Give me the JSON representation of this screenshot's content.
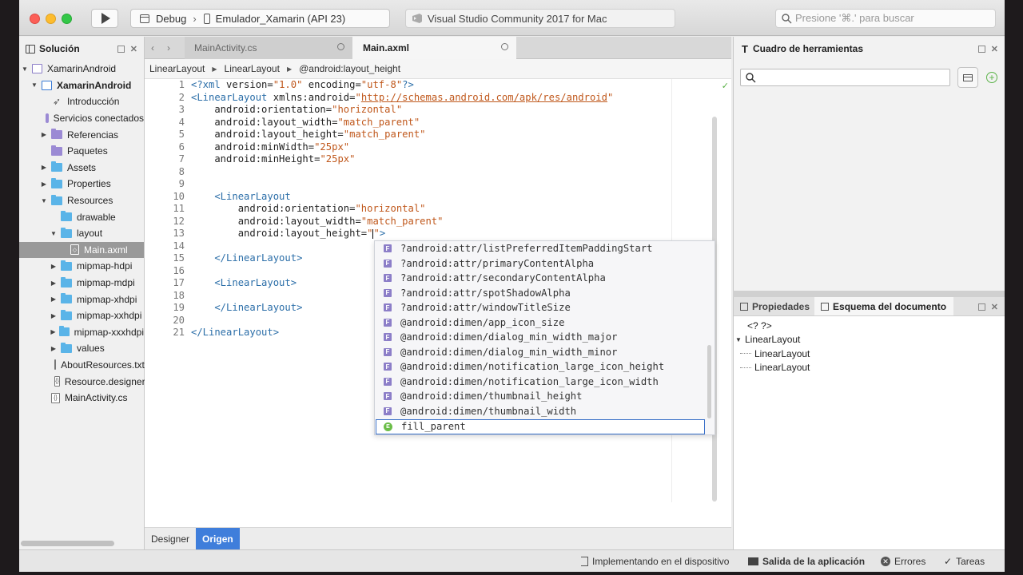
{
  "toolbar": {
    "config": "Debug",
    "device": "Emulador_Xamarin (API 23)",
    "app_title": "Visual Studio Community 2017 for Mac",
    "search_placeholder": "Presione '⌘.' para buscar"
  },
  "solution": {
    "title": "Solución",
    "items": [
      {
        "label": "XamarinAndroid",
        "depth": 0,
        "arrow": "▼",
        "icon": "solution-icon"
      },
      {
        "label": "XamarinAndroid",
        "depth": 1,
        "arrow": "▼",
        "icon": "project-icon",
        "bold": true
      },
      {
        "label": "Introducción",
        "depth": 2,
        "arrow": "",
        "icon": "rocket-icon"
      },
      {
        "label": "Servicios conectados",
        "depth": 2,
        "arrow": "",
        "icon": "services-icon"
      },
      {
        "label": "Referencias",
        "depth": 2,
        "arrow": "▶",
        "icon": "references-folder-icon"
      },
      {
        "label": "Paquetes",
        "depth": 2,
        "arrow": "",
        "icon": "packages-folder-icon"
      },
      {
        "label": "Assets",
        "depth": 2,
        "arrow": "▶",
        "icon": "folder-icon"
      },
      {
        "label": "Properties",
        "depth": 2,
        "arrow": "▶",
        "icon": "folder-icon"
      },
      {
        "label": "Resources",
        "depth": 2,
        "arrow": "▼",
        "icon": "folder-icon"
      },
      {
        "label": "drawable",
        "depth": 3,
        "arrow": "",
        "icon": "folder-icon"
      },
      {
        "label": "layout",
        "depth": 3,
        "arrow": "▼",
        "icon": "folder-icon"
      },
      {
        "label": "Main.axml",
        "depth": 4,
        "arrow": "",
        "icon": "axml-file-icon",
        "selected": true
      },
      {
        "label": "mipmap-hdpi",
        "depth": 3,
        "arrow": "▶",
        "icon": "folder-icon"
      },
      {
        "label": "mipmap-mdpi",
        "depth": 3,
        "arrow": "▶",
        "icon": "folder-icon"
      },
      {
        "label": "mipmap-xhdpi",
        "depth": 3,
        "arrow": "▶",
        "icon": "folder-icon"
      },
      {
        "label": "mipmap-xxhdpi",
        "depth": 3,
        "arrow": "▶",
        "icon": "folder-icon"
      },
      {
        "label": "mipmap-xxxhdpi",
        "depth": 3,
        "arrow": "▶",
        "icon": "folder-icon"
      },
      {
        "label": "values",
        "depth": 3,
        "arrow": "▶",
        "icon": "folder-icon"
      },
      {
        "label": "AboutResources.txt",
        "depth": 3,
        "arrow": "",
        "icon": "text-file-icon"
      },
      {
        "label": "Resource.designer.cs",
        "depth": 3,
        "arrow": "",
        "icon": "cs-file-icon"
      },
      {
        "label": "MainActivity.cs",
        "depth": 2,
        "arrow": "",
        "icon": "cs-file-icon"
      }
    ]
  },
  "tabs": [
    {
      "label": "MainActivity.cs",
      "active": false
    },
    {
      "label": "Main.axml",
      "active": true
    }
  ],
  "breadcrumb": [
    "LinearLayout",
    "LinearLayout",
    "@android:layout_height"
  ],
  "code_lines": [
    {
      "n": "1",
      "parts": [
        [
          "tag",
          "<?xml "
        ],
        [
          "attr",
          "version="
        ],
        [
          "str",
          "\"1.0\""
        ],
        [
          "attr",
          " encoding="
        ],
        [
          "str",
          "\"utf-8\""
        ],
        [
          "tag",
          "?>"
        ]
      ]
    },
    {
      "n": "2",
      "parts": [
        [
          "tag",
          "<LinearLayout "
        ],
        [
          "attr",
          "xmlns:android="
        ],
        [
          "str",
          "\""
        ],
        [
          "url",
          "http://schemas.android.com/apk/res/android"
        ],
        [
          "str",
          "\""
        ]
      ]
    },
    {
      "n": "3",
      "parts": [
        [
          "attr",
          "    android:orientation="
        ],
        [
          "str",
          "\"horizontal\""
        ]
      ]
    },
    {
      "n": "4",
      "parts": [
        [
          "attr",
          "    android:layout_width="
        ],
        [
          "str",
          "\"match_parent\""
        ]
      ]
    },
    {
      "n": "5",
      "parts": [
        [
          "attr",
          "    android:layout_height="
        ],
        [
          "str",
          "\"match_parent\""
        ]
      ]
    },
    {
      "n": "6",
      "parts": [
        [
          "attr",
          "    android:minWidth="
        ],
        [
          "str",
          "\"25px\""
        ]
      ]
    },
    {
      "n": "7",
      "parts": [
        [
          "attr",
          "    android:minHeight="
        ],
        [
          "str",
          "\"25px\""
        ]
      ]
    },
    {
      "n": "8",
      "parts": []
    },
    {
      "n": "9",
      "parts": []
    },
    {
      "n": "10",
      "parts": [
        [
          "tag",
          "    <LinearLayout"
        ]
      ]
    },
    {
      "n": "11",
      "parts": [
        [
          "attr",
          "        android:orientation="
        ],
        [
          "str",
          "\"horizontal\""
        ]
      ]
    },
    {
      "n": "12",
      "parts": [
        [
          "attr",
          "        android:layout_width="
        ],
        [
          "str",
          "\"match_parent\""
        ]
      ]
    },
    {
      "n": "13",
      "parts": [
        [
          "attr",
          "        android:layout_height="
        ],
        [
          "str",
          "\""
        ],
        [
          "cursor",
          ""
        ],
        [
          "str",
          "\""
        ],
        [
          "tag",
          ">"
        ]
      ]
    },
    {
      "n": "14",
      "parts": []
    },
    {
      "n": "15",
      "parts": [
        [
          "tag",
          "    </LinearLayout>"
        ]
      ]
    },
    {
      "n": "16",
      "parts": []
    },
    {
      "n": "17",
      "parts": [
        [
          "tag",
          "    <LinearLayout>"
        ]
      ]
    },
    {
      "n": "18",
      "parts": []
    },
    {
      "n": "19",
      "parts": [
        [
          "tag",
          "    </LinearLayout>"
        ]
      ]
    },
    {
      "n": "20",
      "parts": []
    },
    {
      "n": "21",
      "parts": [
        [
          "tag",
          "</LinearLayout>"
        ]
      ]
    }
  ],
  "completion": {
    "items": [
      {
        "label": "?android:attr/listPreferredItemPaddingStart",
        "icon": "F"
      },
      {
        "label": "?android:attr/primaryContentAlpha",
        "icon": "F"
      },
      {
        "label": "?android:attr/secondaryContentAlpha",
        "icon": "F"
      },
      {
        "label": "?android:attr/spotShadowAlpha",
        "icon": "F"
      },
      {
        "label": "?android:attr/windowTitleSize",
        "icon": "F"
      },
      {
        "label": "@android:dimen/app_icon_size",
        "icon": "F"
      },
      {
        "label": "@android:dimen/dialog_min_width_major",
        "icon": "F"
      },
      {
        "label": "@android:dimen/dialog_min_width_minor",
        "icon": "F"
      },
      {
        "label": "@android:dimen/notification_large_icon_height",
        "icon": "F"
      },
      {
        "label": "@android:dimen/notification_large_icon_width",
        "icon": "F"
      },
      {
        "label": "@android:dimen/thumbnail_height",
        "icon": "F"
      },
      {
        "label": "@android:dimen/thumbnail_width",
        "icon": "F"
      },
      {
        "label": "fill_parent",
        "icon": "E",
        "selected": true
      }
    ]
  },
  "editor_bottom_tabs": {
    "designer": "Designer",
    "source": "Origen"
  },
  "toolbox": {
    "title": "Cuadro de herramientas"
  },
  "doc": {
    "properties_tab": "Propiedades",
    "outline_tab": "Esquema del documento",
    "outline": [
      {
        "label": "<? ?>",
        "depth": 0,
        "arrow": ""
      },
      {
        "label": "LinearLayout",
        "depth": 0,
        "arrow": "▼"
      },
      {
        "label": "LinearLayout",
        "depth": 1,
        "arrow": ""
      },
      {
        "label": "LinearLayout",
        "depth": 1,
        "arrow": ""
      }
    ]
  },
  "status": {
    "deploying": "Implementando en el dispositivo",
    "output": "Salida de la aplicación",
    "errors": "Errores",
    "tasks": "Tareas"
  }
}
